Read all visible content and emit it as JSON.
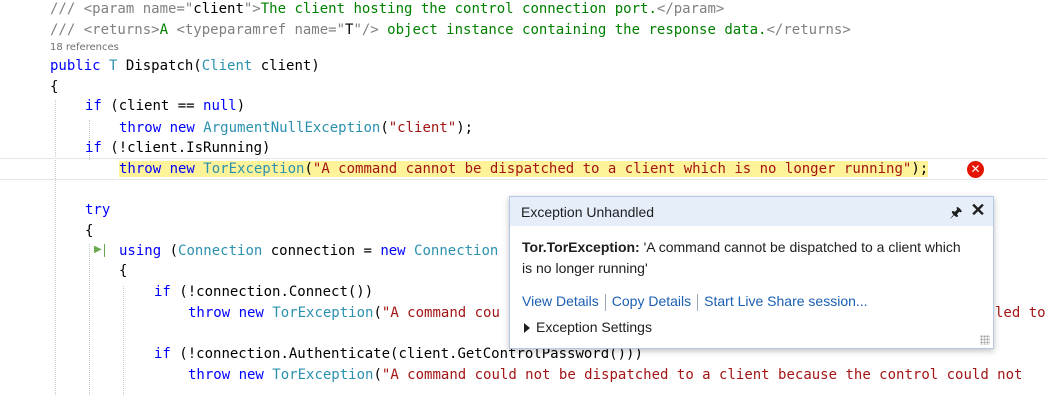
{
  "editor": {
    "references": "18 references",
    "lines": {
      "l1": {
        "a": "/// ",
        "b": "<param name=\"",
        "c": "client",
        "d": "\">",
        "e": "The client hosting the control connection port.",
        "f": "</param>"
      },
      "l2": {
        "a": "/// ",
        "b": "<returns>",
        "c": "A ",
        "d": "<typeparamref name=\"",
        "e": "T",
        "f": "\"/>",
        "g": " object instance containing the response data.",
        "h": "</returns>"
      },
      "l3": {
        "a": "public ",
        "b": "T",
        "c": " Dispatch(",
        "d": "Client",
        "e": " client)"
      },
      "l4": {
        "a": "{"
      },
      "l5": {
        "a": "if ",
        "b": "(client == ",
        "c": "null",
        "d": ")"
      },
      "l6": {
        "a": "throw new ",
        "b": "ArgumentNullException",
        "c": "(",
        "d": "\"client\"",
        "e": ");"
      },
      "l7": {
        "a": "if ",
        "b": "(!client.IsRunning)"
      },
      "l8": {
        "a": "throw new ",
        "b": "TorException",
        "c": "(",
        "d": "\"A command cannot be dispatched to a client which is no longer running\"",
        "e": ");"
      },
      "l9": {
        "a": "try"
      },
      "l10": {
        "a": "{"
      },
      "l11": {
        "a": "using ",
        "b": "(",
        "c": "Connection",
        "d": " connection = ",
        "e": "new ",
        "f": "Connection"
      },
      "l12": {
        "a": "{"
      },
      "l13": {
        "a": "if ",
        "b": "(!connection.Connect())"
      },
      "l14": {
        "a": "throw new ",
        "b": "TorException",
        "c": "(",
        "d": "\"A command cou"
      },
      "l14r": {
        "a": "led to"
      },
      "l15": {
        "a": "if ",
        "b": "(!connection.Authenticate(client.GetControlPassword()))"
      },
      "l16": {
        "a": "throw new ",
        "b": "TorException",
        "c": "(",
        "d": "\"A command could not be dispatched to a client because the control could not"
      }
    }
  },
  "exception_popup": {
    "title": "Exception Unhandled",
    "pin_icon": "pin-icon",
    "close_icon": "close-icon",
    "exception_type": "Tor.TorException:",
    "message": " 'A command cannot be dispatched to a client which is no longer running'",
    "actions": [
      "View Details",
      "Copy Details",
      "Start Live Share session..."
    ],
    "settings_label": "Exception Settings"
  },
  "colors": {
    "keyword": "#0000ff",
    "type": "#2b91af",
    "string": "#a31515",
    "comment": "#008000",
    "highlight": "#fff39a",
    "error": "#e51400"
  }
}
